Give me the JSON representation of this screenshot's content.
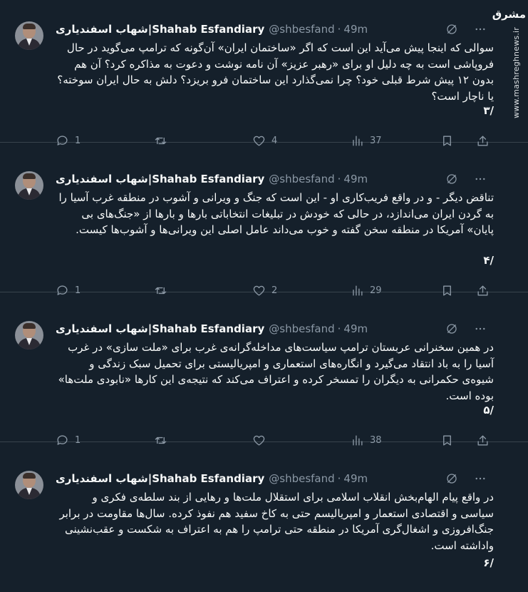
{
  "watermark": {
    "logo_text": "مشرق",
    "url": "www.mashreghnews.ir"
  },
  "tweets": [
    {
      "name": "شهاب اسفندیاری|Shahab Esfandiary",
      "handle": "@shbesfand",
      "separator": "·",
      "time": "49m",
      "text": "سوالی که اینجا پیش می‌آید این است که اگر «ساختمان ایران» آن‌گونه که ترامپ می‌گوید در حال فروپاشی است به چه دلیل او برای «رهبر عزیز» آن نامه نوشت و دعوت به مذاکره کرد؟ آن هم بدون ١٢ پیش شرط قبلی خود؟ چرا نمی‌گذارد این ساختمان فرو بریزد؟ دلش به حال ایران سوخته؟ یا ناچار است؟",
      "number": "/٣",
      "replies": "1",
      "retweets": "",
      "likes": "4",
      "views": "37"
    },
    {
      "name": "شهاب اسفندیاری|Shahab Esfandiary",
      "handle": "@shbesfand",
      "separator": "·",
      "time": "49m",
      "text": "تناقض دیگر - و در واقع فریب‌کاری او - این است که جنگ و ویرانی و آشوب در منطقه غرب آسیا را به گردن ایران می‌اندازد، در حالی که خودش در تبلیغات انتخاباتی بارها و بارها از «جنگ‌های بی پایان» آمریکا در منطقه سخن گفته و خوب می‌داند عامل اصلی این ویرانی‌ها و آشوب‌ها کیست.",
      "number": "/۴",
      "replies": "1",
      "retweets": "",
      "likes": "2",
      "views": "29"
    },
    {
      "name": "شهاب اسفندیاری|Shahab Esfandiary",
      "handle": "@shbesfand",
      "separator": "·",
      "time": "49m",
      "text": "در همین سخنرانی عربستان ترامپ سیاست‌های مداخله‌گرانه‌ی غرب برای «ملت سازی» در غرب آسیا را به باد انتقاد می‌گیرد و انگاره‌های استعماری و امپریالیستی برای تحمیل سبک زندگی و شیوه‌ی حکمرانی به دیگران را تمسخر کرده و اعتراف می‌کند که نتیجه‌ی این کارها «نابودی ملت‌ها» بوده است.",
      "number": "/۵",
      "replies": "1",
      "retweets": "",
      "likes": "",
      "views": "38"
    },
    {
      "name": "شهاب اسفندیاری|Shahab Esfandiary",
      "handle": "@shbesfand",
      "separator": "·",
      "time": "49m",
      "text": "در واقع پیام الهام‌بخش انقلاب اسلامی برای استقلال ملت‌ها و رهایی از بند سلطه‌ی فکری و سیاسی و اقتصادی استعمار و امپریالیسم حتی به کاخ سفید هم نفوذ کرده. سال‌ها مقاومت در برابر جنگ‌افروزی و اشغال‌گری آمریکا در منطقه حتی ترامپ را هم به اعتراف به شکست و عقب‌نشینی واداشته است.",
      "number": "/۶",
      "replies": "",
      "retweets": "",
      "likes": "",
      "views": ""
    }
  ]
}
